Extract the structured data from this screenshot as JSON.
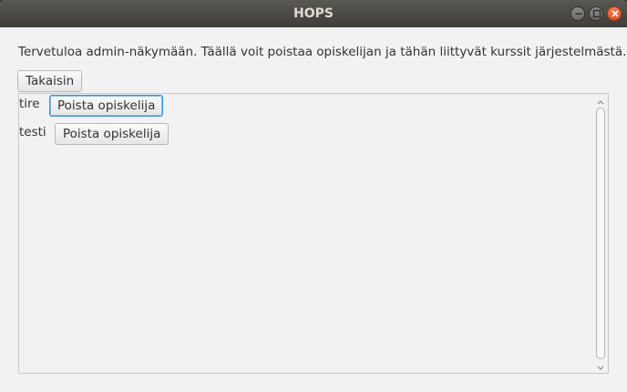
{
  "window": {
    "title": "HOPS"
  },
  "content": {
    "info_text": "Tervetuloa admin-näkymään. Täällä voit poistaa opiskelijan ja tähän liittyvät kurssit järjestelmästä.",
    "back_label": "Takaisin",
    "students": [
      {
        "name": "tire",
        "button_label": "Poista opiskelija"
      },
      {
        "name": "testi",
        "button_label": "Poista opiskelija"
      }
    ]
  },
  "colors": {
    "close_button": "#e2501f",
    "focus_ring": "#3a95d6",
    "titlebar": "#3f3d39"
  },
  "icons": [
    "minimize-icon",
    "maximize-icon",
    "close-icon",
    "scroll-up-icon",
    "scroll-down-icon"
  ]
}
